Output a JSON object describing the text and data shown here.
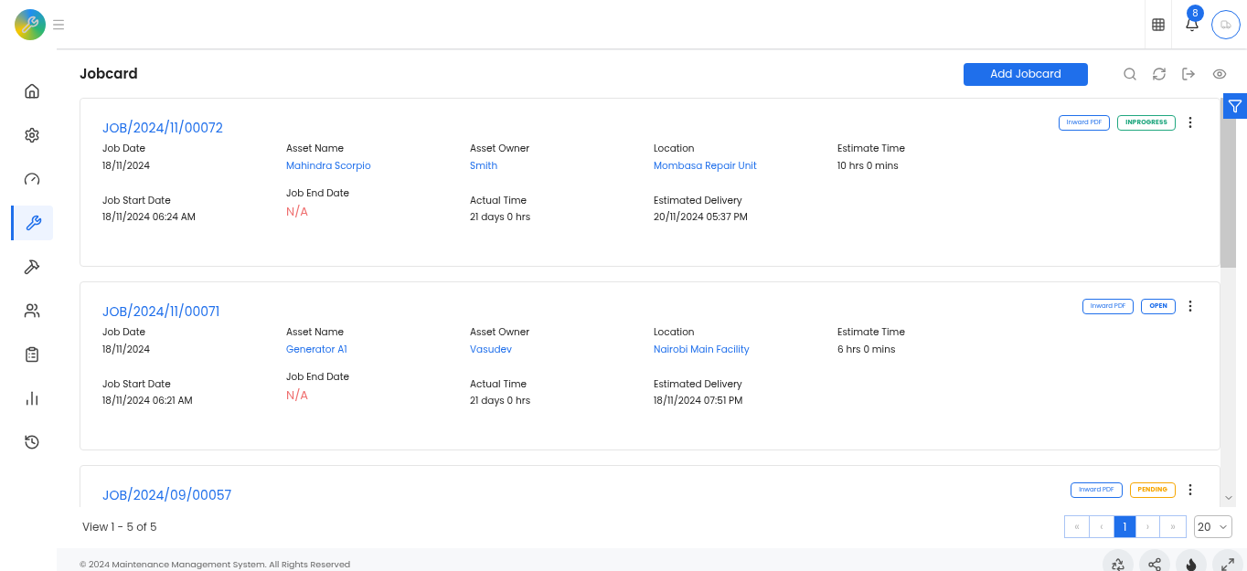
{
  "header": {
    "notification_count": "8"
  },
  "sidebar": {
    "items": [
      {
        "selected": false
      },
      {
        "selected": false
      },
      {
        "selected": false
      },
      {
        "selected": true
      },
      {
        "selected": false
      },
      {
        "selected": false
      },
      {
        "selected": false
      },
      {
        "selected": false
      },
      {
        "selected": false
      }
    ]
  },
  "page": {
    "title": "Jobcard",
    "add_button": "Add Jobcard"
  },
  "jobs": [
    {
      "number": "JOB/2024/11/00072",
      "pdf_button": "Inward PDF",
      "status": {
        "label": "INPROGRESS",
        "color": "#20a77f"
      },
      "fields": [
        {
          "label": "Job Date",
          "value": "18/11/2024",
          "kind": "plain"
        },
        {
          "label": "Asset Name",
          "value": "Mahindra Scorpio",
          "kind": "link"
        },
        {
          "label": "Asset Owner",
          "value": "Smith",
          "kind": "link"
        },
        {
          "label": "Location",
          "value": "Mombasa Repair Unit",
          "kind": "link"
        },
        {
          "label": "Estimate Time",
          "value": "10 hrs 0 mins",
          "kind": "plain"
        },
        {
          "label": "Job Start Date",
          "value": "18/11/2024 06:24 AM",
          "kind": "plain"
        },
        {
          "label": "Job End Date",
          "value": "N/A",
          "kind": "missing"
        },
        {
          "label": "Actual Time",
          "value": "21 days 0 hrs",
          "kind": "plain"
        },
        {
          "label": "Estimated Delivery",
          "value": "20/11/2024 05:37 PM",
          "kind": "plain"
        }
      ]
    },
    {
      "number": "JOB/2024/11/00071",
      "pdf_button": "Inward PDF",
      "status": {
        "label": "OPEN",
        "color": "#1f6feb"
      },
      "fields": [
        {
          "label": "Job Date",
          "value": "18/11/2024",
          "kind": "plain"
        },
        {
          "label": "Asset Name",
          "value": "Generator A1",
          "kind": "link"
        },
        {
          "label": "Asset Owner",
          "value": "Vasudev",
          "kind": "link"
        },
        {
          "label": "Location",
          "value": "Nairobi Main Facility",
          "kind": "link"
        },
        {
          "label": "Estimate Time",
          "value": "6 hrs 0 mins",
          "kind": "plain"
        },
        {
          "label": "Job Start Date",
          "value": "18/11/2024 06:21 AM",
          "kind": "plain"
        },
        {
          "label": "Job End Date",
          "value": "N/A",
          "kind": "missing"
        },
        {
          "label": "Actual Time",
          "value": "21 days 0 hrs",
          "kind": "plain"
        },
        {
          "label": "Estimated Delivery",
          "value": "18/11/2024 07:51 PM",
          "kind": "plain"
        }
      ]
    },
    {
      "number": "JOB/2024/09/00057",
      "pdf_button": "Inward PDF",
      "status": {
        "label": "PENDING",
        "color": "#f7a600"
      }
    }
  ],
  "pagination": {
    "summary": "View 1 - 5 of 5",
    "first": "«",
    "prev": "‹",
    "pages": [
      {
        "label": "1",
        "selected": true
      }
    ],
    "next": "›",
    "last": "»",
    "page_size": "20"
  },
  "footer": {
    "text": "© 2024 Maintenance Management System. All Rights Reserved"
  }
}
